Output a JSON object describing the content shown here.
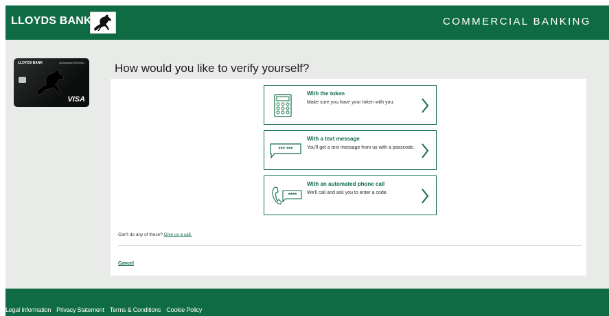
{
  "header": {
    "brand": "LLOYDS BANK",
    "section_title": "COMMERCIAL BANKING"
  },
  "card": {
    "bank_name": "LLOYDS BANK",
    "small_text": "Commercial STERLING",
    "network": "VISA"
  },
  "main": {
    "title": "How would you like to verify yourself?",
    "options": [
      {
        "title": "With the token",
        "description": "Make sure you have your token with you.",
        "icon": "token-icon"
      },
      {
        "title": "With a text message",
        "description": "You'll get a text message from us with a passcode.",
        "icon": "text-message-icon",
        "icon_text": "*** ***"
      },
      {
        "title": "With an automated phone call",
        "description": "We'll call and ask you to enter a code.",
        "icon": "phone-call-icon",
        "icon_text": "****"
      }
    ],
    "help_prefix": "Can't do any of these?",
    "help_link": "Give us a call.",
    "cancel_label": "Cancel"
  },
  "footer": {
    "links": [
      "Legal Information",
      "Privacy Statement",
      "Terms & Conditions",
      "Cookie Policy"
    ]
  },
  "colors": {
    "brand_green": "#0f6b43",
    "background": "#e9ebe9"
  }
}
